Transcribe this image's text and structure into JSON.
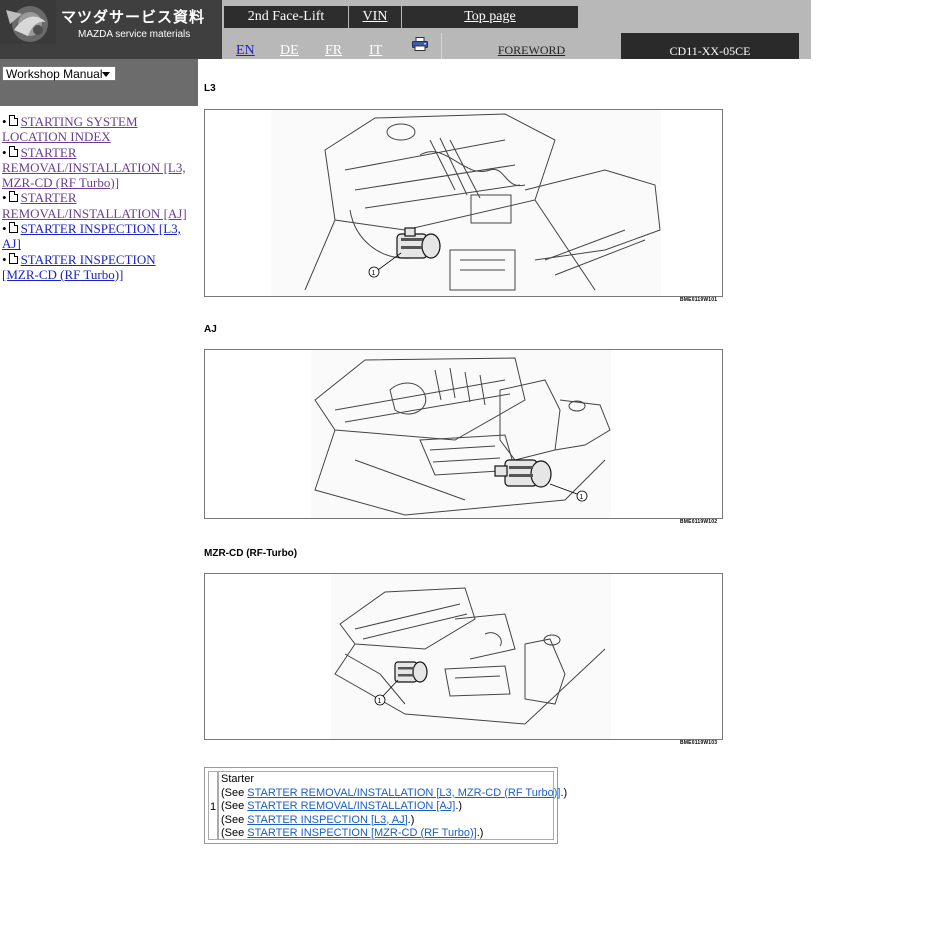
{
  "header": {
    "logo_title_jp": "マツダサービス資料",
    "logo_subtitle": "MAZDA service materials",
    "facelift_label": "2nd Face-Lift",
    "vin_label": "VIN",
    "top_page_label": "Top page",
    "languages": [
      "EN",
      "DE",
      "FR",
      "IT"
    ],
    "active_language": "EN",
    "print_icon": "printer-icon",
    "foreword_label": "FOREWORD",
    "document_code": "CD11-XX-05CE"
  },
  "sidebar": {
    "manual_select": "Workshop Manual",
    "items": [
      {
        "bullet": "•",
        "label": "STARTING SYSTEM LOCATION INDEX",
        "visited": true
      },
      {
        "bullet": "•",
        "label": "STARTER REMOVAL/INSTALLATION [L3, MZR-CD (RF Turbo)]",
        "visited": true
      },
      {
        "bullet": "•",
        "label": "STARTER REMOVAL/INSTALLATION [AJ]",
        "visited": true
      },
      {
        "bullet": "•",
        "label": "STARTER INSPECTION [L3, AJ]",
        "visited": false
      },
      {
        "bullet": "•",
        "label": "STARTER INSPECTION [MZR-CD (RF Turbo)]",
        "visited": false
      }
    ]
  },
  "main": {
    "sections": [
      {
        "title": "L3",
        "figure_code": "BME0119W101",
        "callout": "1"
      },
      {
        "title": "AJ",
        "figure_code": "BME0119W102",
        "callout": "1"
      },
      {
        "title": "MZR-CD (RF-Turbo)",
        "figure_code": "BME0119W103",
        "callout": "1"
      }
    ],
    "callout_table": {
      "number": "1",
      "heading": "Starter",
      "see_prefix": "(See ",
      "see_suffix": ".)",
      "links": [
        "STARTER REMOVAL/INSTALLATION [L3, MZR-CD (RF Turbo)]",
        "STARTER REMOVAL/INSTALLATION [AJ]",
        "STARTER INSPECTION [L3, AJ]",
        "STARTER INSPECTION [MZR-CD (RF Turbo)]"
      ]
    }
  },
  "colors": {
    "header_gray": "#b8b8b8",
    "header_dark": "#2d2d2d",
    "sidebar_gray": "#6c6c6c",
    "visited_link": "#6b3e8f",
    "link_blue": "#1a22c8"
  }
}
